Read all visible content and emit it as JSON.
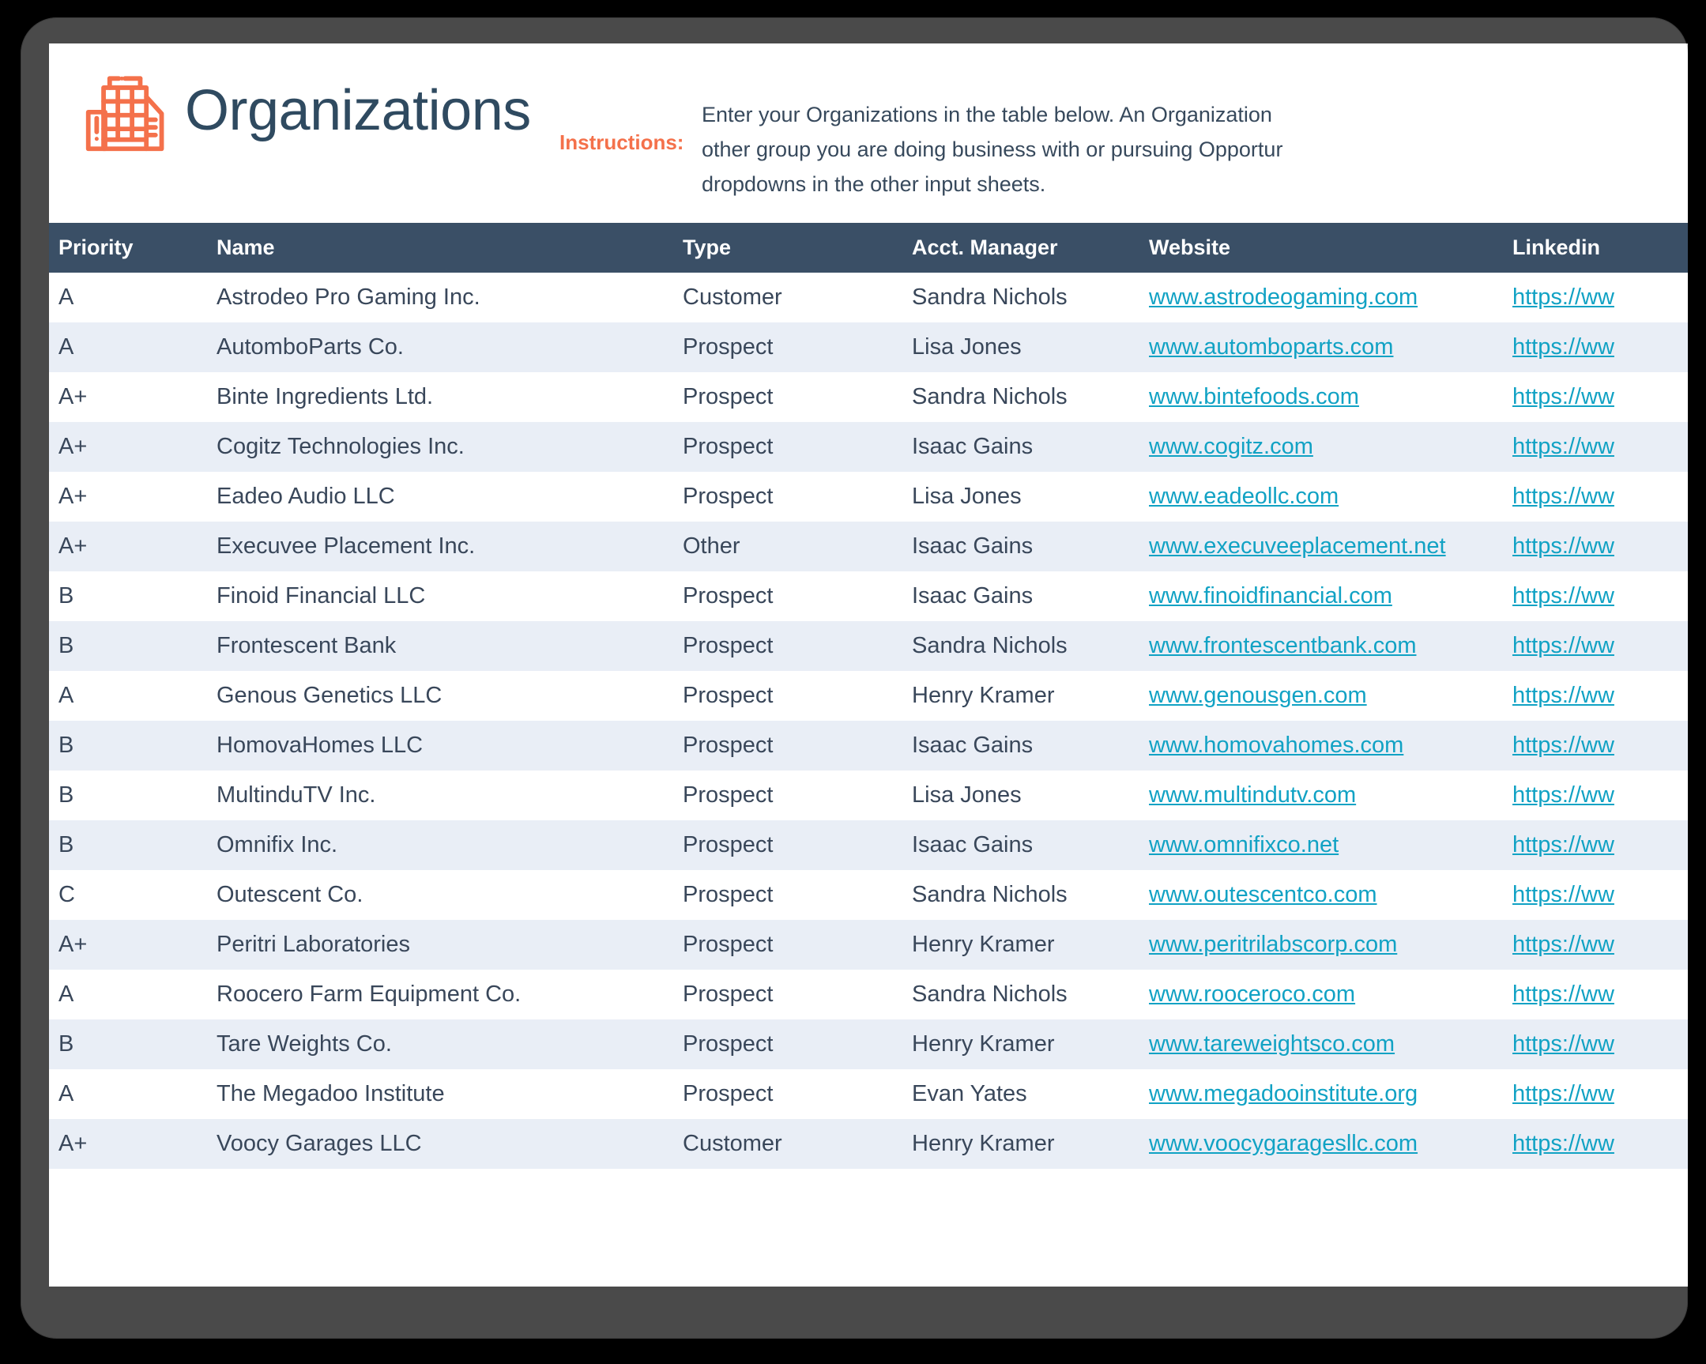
{
  "header": {
    "title": "Organizations",
    "icon": "office-building-icon",
    "instructions_label": "Instructions:",
    "instructions_lines": [
      "Enter your Organizations in the table below. An Organization",
      "other group you are doing business with or pursuing Opportur",
      "dropdowns in the other input sheets."
    ]
  },
  "colors": {
    "accent_orange": "#f4714b",
    "header_navy": "#3a4f66",
    "link_cyan": "#11a2c4",
    "row_alt": "#e9eef6",
    "text_navy": "#39475a",
    "frame_gray": "#4a4a4a"
  },
  "table": {
    "columns": [
      "Priority",
      "Name",
      "Type",
      "Acct. Manager",
      "Website",
      "Linkedin"
    ],
    "rows": [
      {
        "priority": "A",
        "name": "Astrodeo Pro Gaming Inc.",
        "type": "Customer",
        "manager": "Sandra Nichols",
        "website": "www.astrodeogaming.com",
        "linkedin": "https://ww"
      },
      {
        "priority": "A",
        "name": "AutomboParts Co.",
        "type": "Prospect",
        "manager": "Lisa Jones",
        "website": "www.automboparts.com",
        "linkedin": "https://ww"
      },
      {
        "priority": "A+",
        "name": "Binte Ingredients Ltd.",
        "type": "Prospect",
        "manager": "Sandra Nichols",
        "website": "www.bintefoods.com",
        "linkedin": "https://ww"
      },
      {
        "priority": "A+",
        "name": "Cogitz Technologies Inc.",
        "type": "Prospect",
        "manager": "Isaac Gains",
        "website": "www.cogitz.com",
        "linkedin": "https://ww"
      },
      {
        "priority": "A+",
        "name": "Eadeo Audio LLC",
        "type": "Prospect",
        "manager": "Lisa Jones",
        "website": "www.eadeollc.com",
        "linkedin": "https://ww"
      },
      {
        "priority": "A+",
        "name": "Execuvee Placement Inc.",
        "type": "Other",
        "manager": "Isaac Gains",
        "website": "www.execuveeplacement.net",
        "linkedin": "https://ww"
      },
      {
        "priority": "B",
        "name": "Finoid Financial LLC",
        "type": "Prospect",
        "manager": "Isaac Gains",
        "website": "www.finoidfinancial.com",
        "linkedin": "https://ww"
      },
      {
        "priority": "B",
        "name": "Frontescent Bank",
        "type": "Prospect",
        "manager": "Sandra Nichols",
        "website": "www.frontescentbank.com",
        "linkedin": "https://ww"
      },
      {
        "priority": "A",
        "name": "Genous Genetics LLC",
        "type": "Prospect",
        "manager": "Henry Kramer",
        "website": "www.genousgen.com",
        "linkedin": "https://ww"
      },
      {
        "priority": "B",
        "name": "HomovaHomes LLC",
        "type": "Prospect",
        "manager": "Isaac Gains",
        "website": "www.homovahomes.com",
        "linkedin": "https://ww"
      },
      {
        "priority": "B",
        "name": "MultinduTV Inc.",
        "type": "Prospect",
        "manager": "Lisa Jones",
        "website": "www.multindutv.com",
        "linkedin": "https://ww"
      },
      {
        "priority": "B",
        "name": "Omnifix Inc.",
        "type": "Prospect",
        "manager": "Isaac Gains",
        "website": "www.omnifixco.net",
        "linkedin": "https://ww"
      },
      {
        "priority": "C",
        "name": "Outescent Co.",
        "type": "Prospect",
        "manager": "Sandra Nichols",
        "website": "www.outescentco.com",
        "linkedin": "https://ww"
      },
      {
        "priority": "A+",
        "name": "Peritri Laboratories",
        "type": "Prospect",
        "manager": "Henry Kramer",
        "website": "www.peritrilabscorp.com",
        "linkedin": "https://ww"
      },
      {
        "priority": "A",
        "name": "Roocero Farm Equipment Co.",
        "type": "Prospect",
        "manager": "Sandra Nichols",
        "website": "www.rooceroco.com",
        "linkedin": "https://ww"
      },
      {
        "priority": "B",
        "name": "Tare Weights Co.",
        "type": "Prospect",
        "manager": "Henry Kramer",
        "website": "www.tareweightsco.com",
        "linkedin": "https://ww"
      },
      {
        "priority": "A",
        "name": "The Megadoo Institute",
        "type": "Prospect",
        "manager": "Evan Yates",
        "website": "www.megadooinstitute.org",
        "linkedin": "https://ww"
      },
      {
        "priority": "A+",
        "name": "Voocy Garages LLC",
        "type": "Customer",
        "manager": "Henry Kramer",
        "website": "www.voocygaragesllc.com",
        "linkedin": "https://ww"
      }
    ]
  }
}
